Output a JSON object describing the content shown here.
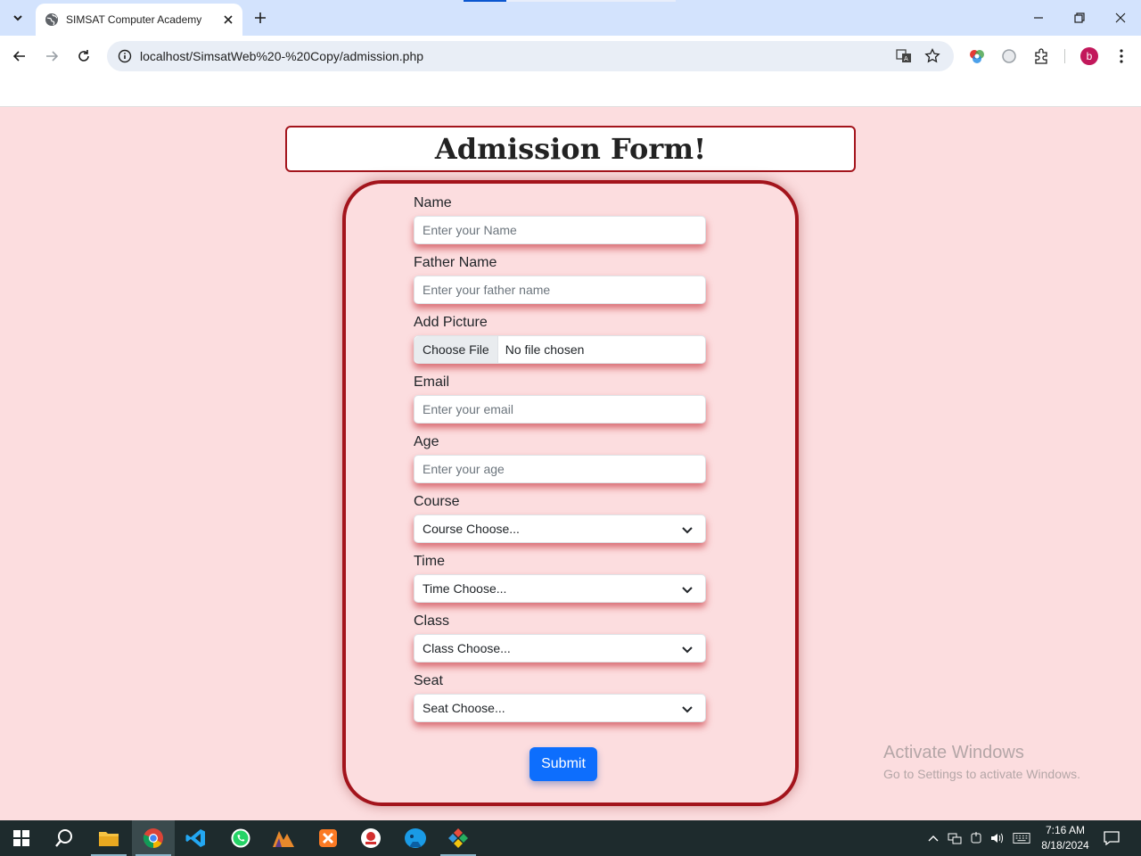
{
  "browser": {
    "tab_title": "SIMSAT Computer Academy",
    "url": "localhost/SimsatWeb%20-%20Copy/admission.php",
    "profile_initial": "b"
  },
  "page": {
    "heading": "Admission Form!",
    "fields": {
      "name": {
        "label": "Name",
        "placeholder": "Enter your Name"
      },
      "father_name": {
        "label": "Father Name",
        "placeholder": "Enter your father name"
      },
      "picture": {
        "label": "Add Picture",
        "button": "Choose File",
        "status": "No file chosen"
      },
      "email": {
        "label": "Email",
        "placeholder": "Enter your email"
      },
      "age": {
        "label": "Age",
        "placeholder": "Enter your age"
      },
      "course": {
        "label": "Course",
        "selected": "Course Choose..."
      },
      "time": {
        "label": "Time",
        "selected": "Time Choose..."
      },
      "class": {
        "label": "Class",
        "selected": "Class Choose..."
      },
      "seat": {
        "label": "Seat",
        "selected": "Seat Choose..."
      }
    },
    "submit_label": "Submit"
  },
  "watermark": {
    "line1": "Activate Windows",
    "line2": "Go to Settings to activate Windows."
  },
  "taskbar": {
    "time": "7:16 AM",
    "date": "8/18/2024",
    "apps": [
      "start-icon",
      "search-icon",
      "file-explorer-icon",
      "chrome-icon",
      "vscode-icon",
      "whatsapp-icon",
      "app-icon",
      "xampp-icon",
      "app-icon",
      "app-icon",
      "app-icon"
    ]
  },
  "colors": {
    "page_bg": "#fcdddf",
    "accent_border": "#a3141c",
    "submit_bg": "#0d6efd"
  }
}
